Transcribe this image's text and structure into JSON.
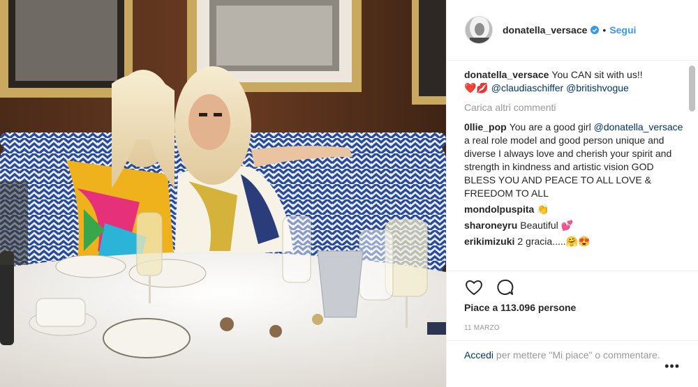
{
  "header": {
    "username": "donatella_versace",
    "separator": "•",
    "follow_label": "Segui",
    "verified_icon": "verified-badge-icon"
  },
  "caption": {
    "username": "donatella_versace",
    "text": "You CAN sit with us!!",
    "emoji": "❤️💋",
    "mention_1": "@claudiaschiffer",
    "mention_2": "@britishvogue"
  },
  "load_more": "Carica altri commenti",
  "comments": [
    {
      "user": "0llie_pop",
      "text_before": "You are a good girl",
      "mention": "@donatella_versace",
      "text_after": "a real role model and good person unique and diverse I always love and cherish your spirit and strength in kindness and artistic vision GOD BLESS YOU AND PEACE TO ALL LOVE & FREEDOM TO ALL"
    },
    {
      "user": "mondolpuspita",
      "text": "👏"
    },
    {
      "user": "sharoneyru",
      "text": "Beautiful 💕"
    },
    {
      "user": "erikimizuki",
      "text": "2 gracia.....🤗😍"
    }
  ],
  "actions": {
    "like_icon": "heart-icon",
    "comment_icon": "comment-icon",
    "likes_text": "Piace a 113.096 persone",
    "date": "11 MARZO"
  },
  "login": {
    "link": "Accedi",
    "text": "per mettere \"Mi piace\" o commentare.",
    "more_label": "•••"
  },
  "colors": {
    "link_blue": "#3897f0",
    "mention_blue": "#003569",
    "muted": "#999999",
    "text": "#262626"
  }
}
